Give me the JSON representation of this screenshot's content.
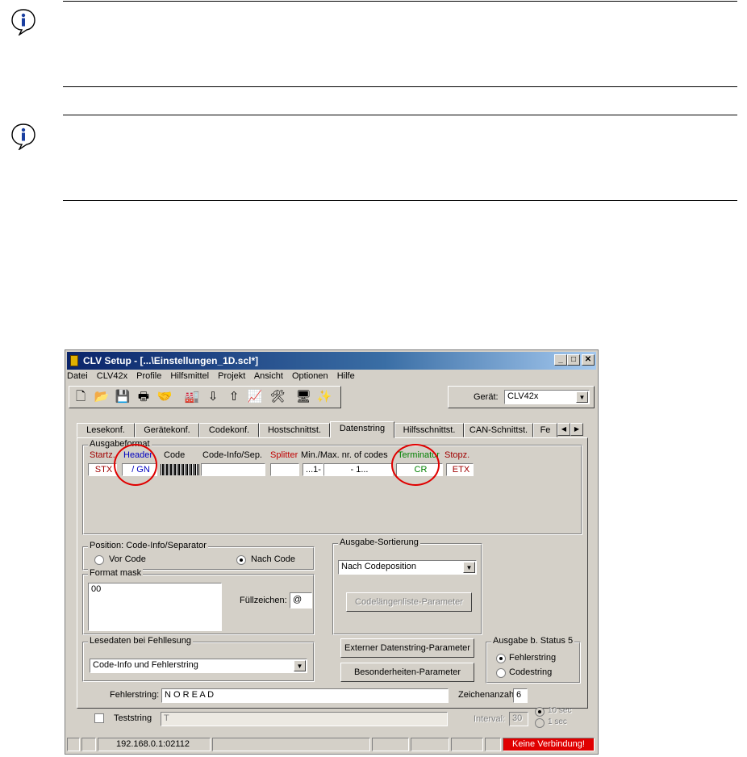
{
  "window": {
    "title": "CLV Setup - [...\\Einstellungen_1D.scl*]",
    "min": "_",
    "max": "□",
    "close": "✕"
  },
  "menu": [
    "Datei",
    "CLV42x",
    "Profile",
    "Hilfsmittel",
    "Projekt",
    "Ansicht",
    "Optionen",
    "Hilfe"
  ],
  "toolbar": {
    "icons": [
      "new-file-icon",
      "open-folder-icon",
      "save-icon",
      "print-icon",
      "handshake-icon",
      "device-upload-icon",
      "download-to-device-icon",
      "upload-from-device-icon",
      "chart-icon",
      "tools-icon",
      "monitor-icon",
      "wizard-icon"
    ],
    "glyphs": [
      "🗋",
      "📂",
      "💾",
      "🖶",
      "🤝",
      "🏭",
      "⇩",
      "⇧",
      "📈",
      "🛠",
      "🖥",
      "✨"
    ],
    "device_label": "Gerät:",
    "device_value": "CLV42x"
  },
  "tabs": [
    "Lesekonf.",
    "Gerätekonf.",
    "Codekonf.",
    "Hostschnittst.",
    "Datenstring",
    "Hilfsschnittst.",
    "CAN-Schnittst.",
    "Fe"
  ],
  "active_tab": "Datenstring",
  "ausgabeformat": {
    "label": "Ausgabeformat",
    "cols": {
      "startz": "Startz.",
      "header": "Header",
      "code": "Code",
      "codeinfo": "Code-Info/Sep.",
      "splitter": "Splitter",
      "minmax": "Min./Max. nr. of codes",
      "terminator": "Terminator",
      "stopz": "Stopz."
    },
    "values": {
      "startz": "STX",
      "header": "/ GN",
      "minmax_a": "...1-",
      "minmax_b": "- 1...",
      "terminator": "CR",
      "stopz": "ETX"
    },
    "colors": {
      "startz": "#a00000",
      "header": "#0000c0",
      "splitter": "#c00000",
      "terminator": "#008000",
      "stopz": "#a00000"
    }
  },
  "position": {
    "label": "Position: Code-Info/Separator",
    "vor": "Vor Code",
    "nach": "Nach Code",
    "selected": "nach"
  },
  "format_mask": {
    "label": "Format mask",
    "value": "00",
    "fill_label": "Füllzeichen:",
    "fill_value": "@"
  },
  "sortierung": {
    "label": "Ausgabe-Sortierung",
    "value": "Nach Codeposition",
    "button": "Codelängenliste-Parameter"
  },
  "lesedaten": {
    "label": "Lesedaten bei Fehllesung",
    "value": "Code-Info und Fehlerstring"
  },
  "buttons": {
    "extern": "Externer Datenstring-Parameter",
    "besonder": "Besonderheiten-Parameter"
  },
  "status5": {
    "label": "Ausgabe b. Status 5",
    "fehler": "Fehlerstring",
    "code": "Codestring",
    "selected": "fehler"
  },
  "fehlerstring": {
    "label": "Fehlerstring:",
    "value": "N O R E A D",
    "count_label": "Zeichenanzahl",
    "count": "6"
  },
  "teststring": {
    "label": "Teststring",
    "value": "T",
    "interval_label": "Interval:",
    "interval": "30",
    "opt10": "10 sec",
    "opt1": "1 sec"
  },
  "status": {
    "address": "192.168.0.1:02112",
    "connection": "Keine Verbindung!"
  }
}
